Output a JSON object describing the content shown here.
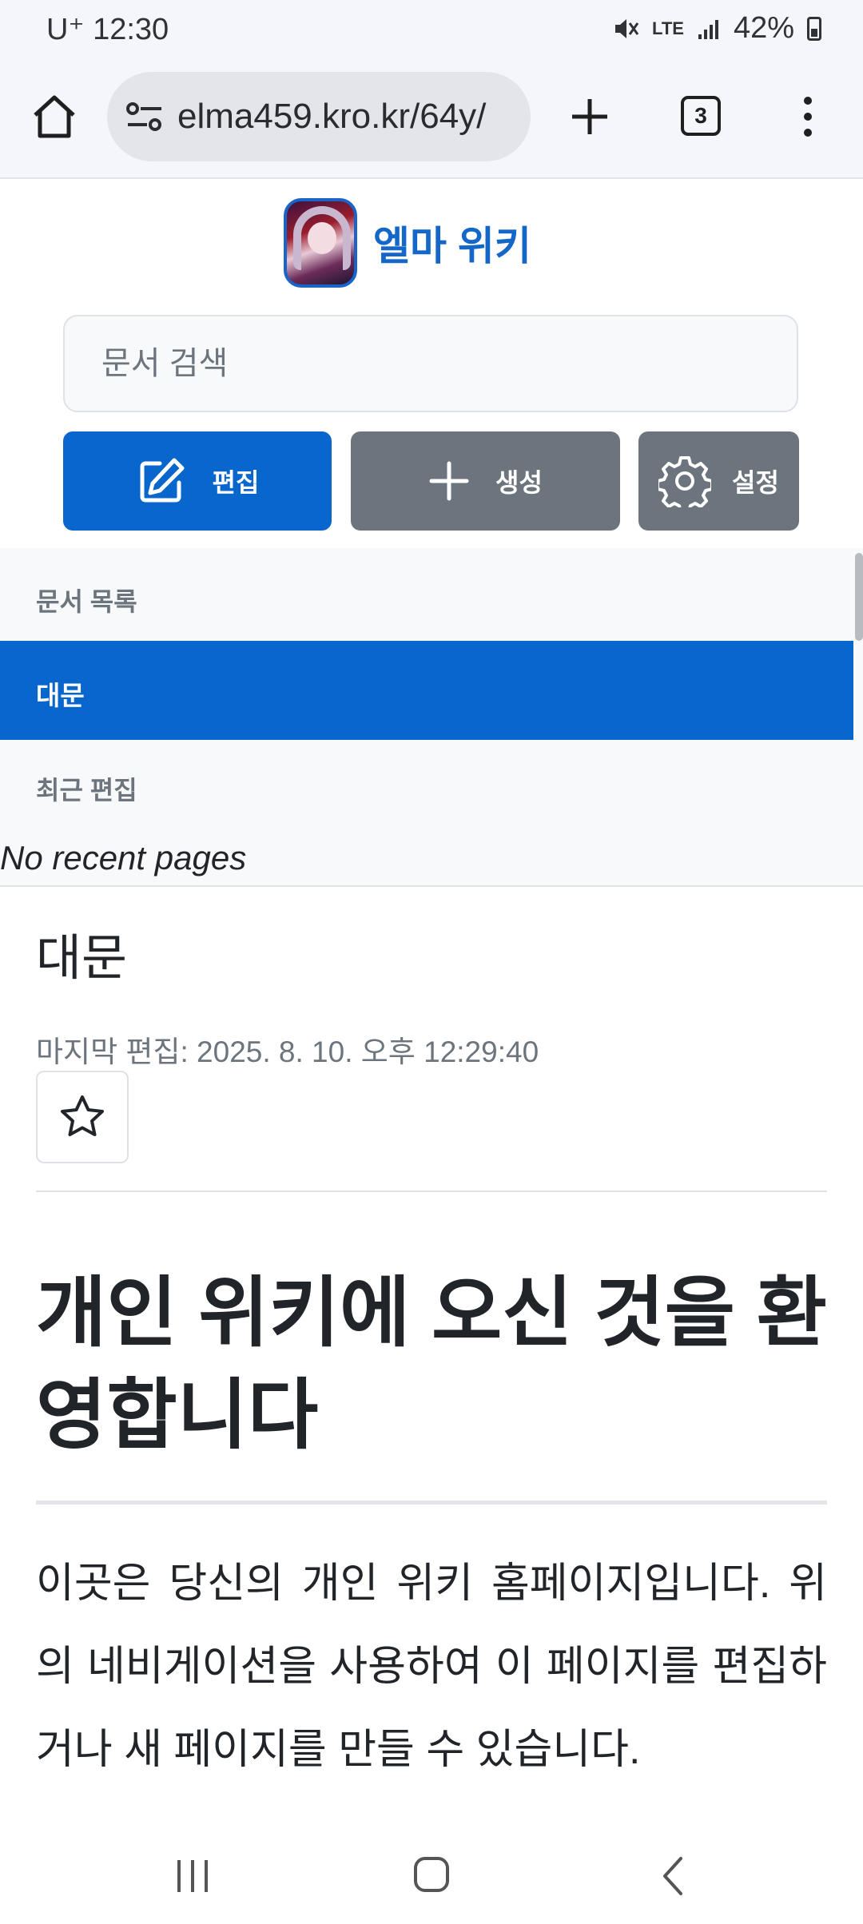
{
  "status_bar": {
    "carrier": "U⁺",
    "time": "12:30",
    "network": "LTE",
    "battery": "42%"
  },
  "browser": {
    "url": "elma459.kro.kr/64y/",
    "tab_count": "3"
  },
  "site": {
    "title": "엘마 위키",
    "search_placeholder": "문서 검색",
    "buttons": {
      "edit": "편집",
      "create": "생성",
      "settings": "설정"
    }
  },
  "sidebar": {
    "documents_heading": "문서 목록",
    "active_item": "대문",
    "recent_heading": "최근 편집",
    "no_recent": "No recent pages"
  },
  "page": {
    "title": "대문",
    "last_edited": "마지막 편집: 2025. 8. 10. 오후 12:29:40",
    "headline": "개인 위키에 오신 것을 환영합니다",
    "paragraph": "이곳은 당신의 개인 위키 홈페이지입니다. 위의 네비게이션을 사용하여 이 페이지를 편집하거나 새 페이지를 만들 수 있습니다."
  }
}
